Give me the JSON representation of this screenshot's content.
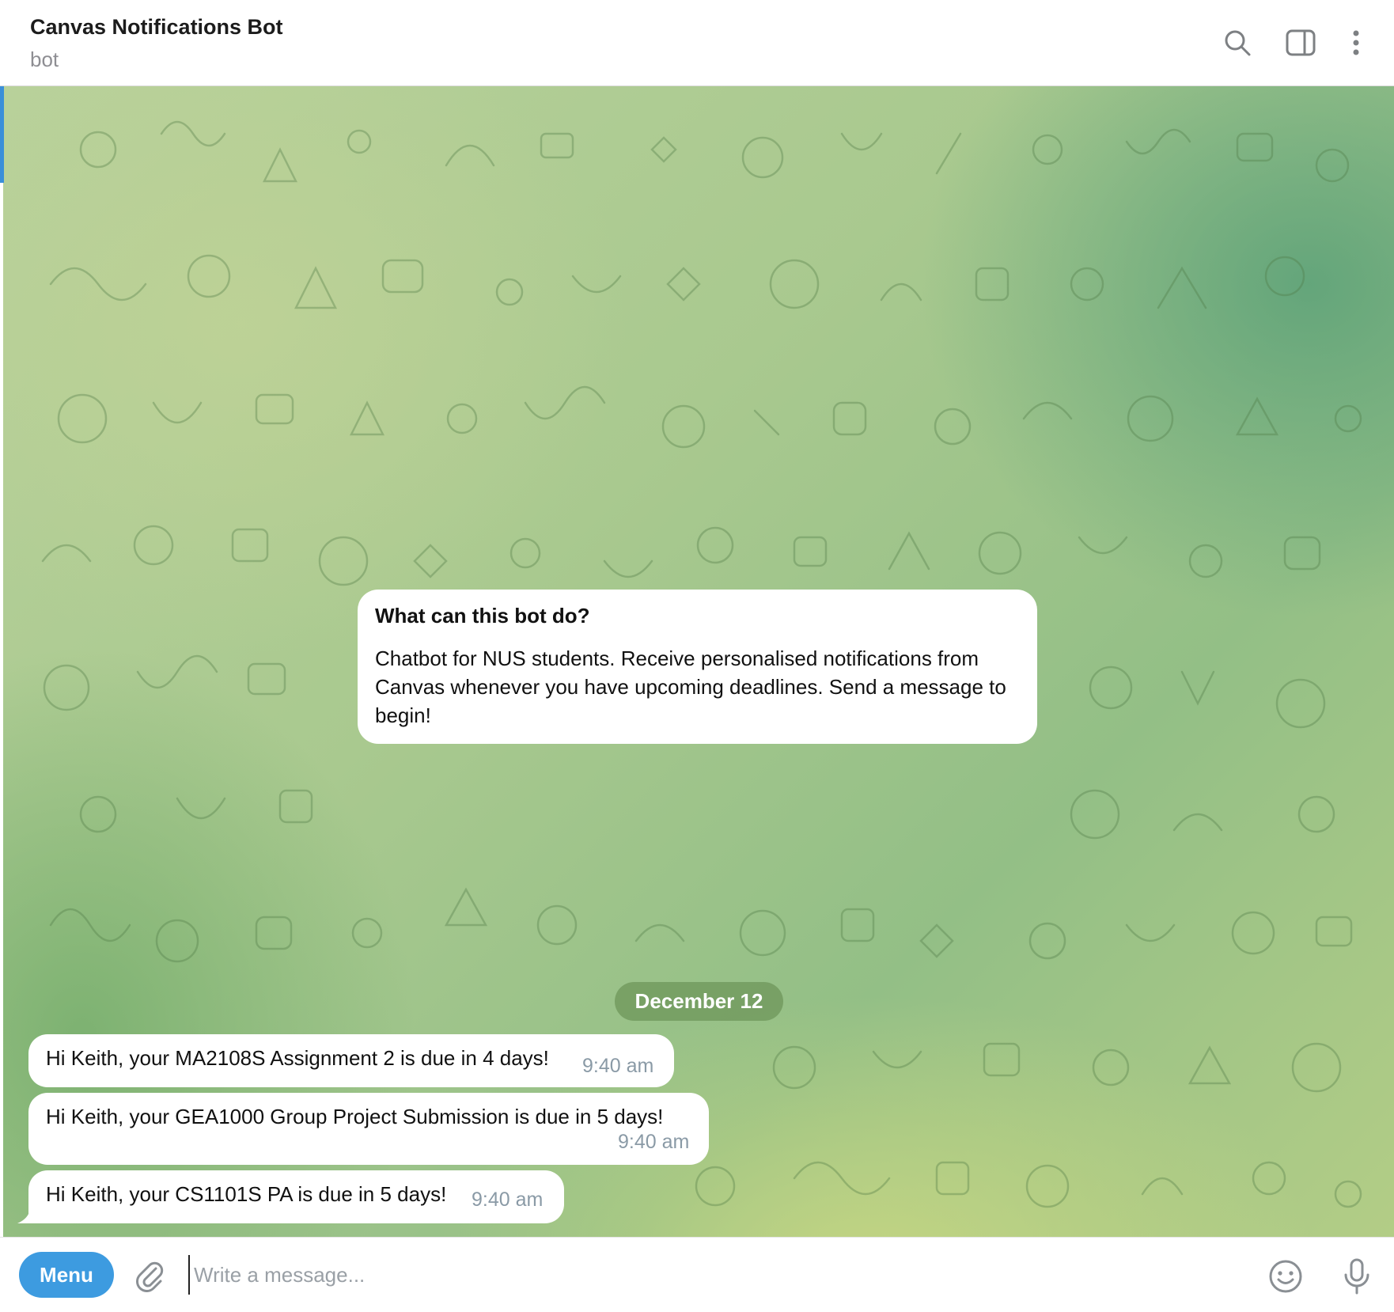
{
  "header": {
    "title": "Canvas Notifications Bot",
    "subtitle": "bot",
    "icons": [
      "search-icon",
      "sidebar-toggle-icon",
      "more-options-icon"
    ]
  },
  "intro": {
    "title": "What can this bot do?",
    "body": "Chatbot for NUS students. Receive personalised notifications from Canvas whenever you have upcoming deadlines. Send a message to begin!"
  },
  "date_separator": "December 12",
  "messages": [
    {
      "text": "Hi Keith, your MA2108S Assignment 2 is due in 4 days!",
      "time": "9:40 am"
    },
    {
      "text": "Hi Keith, your GEA1000 Group Project Submission is due in 5 days!",
      "time": "9:40 am"
    },
    {
      "text": "Hi Keith, your CS1101S PA is due in 5 days!",
      "time": "9:40 am"
    }
  ],
  "composer": {
    "menu_label": "Menu",
    "placeholder": "Write a message...",
    "value": "",
    "icons": [
      "paperclip-icon",
      "emoji-icon",
      "microphone-icon"
    ]
  },
  "colors": {
    "accent": "#3d9be0",
    "bubble": "#ffffff",
    "time_text": "#8a9aa6",
    "date_chip": "#6e965a"
  }
}
